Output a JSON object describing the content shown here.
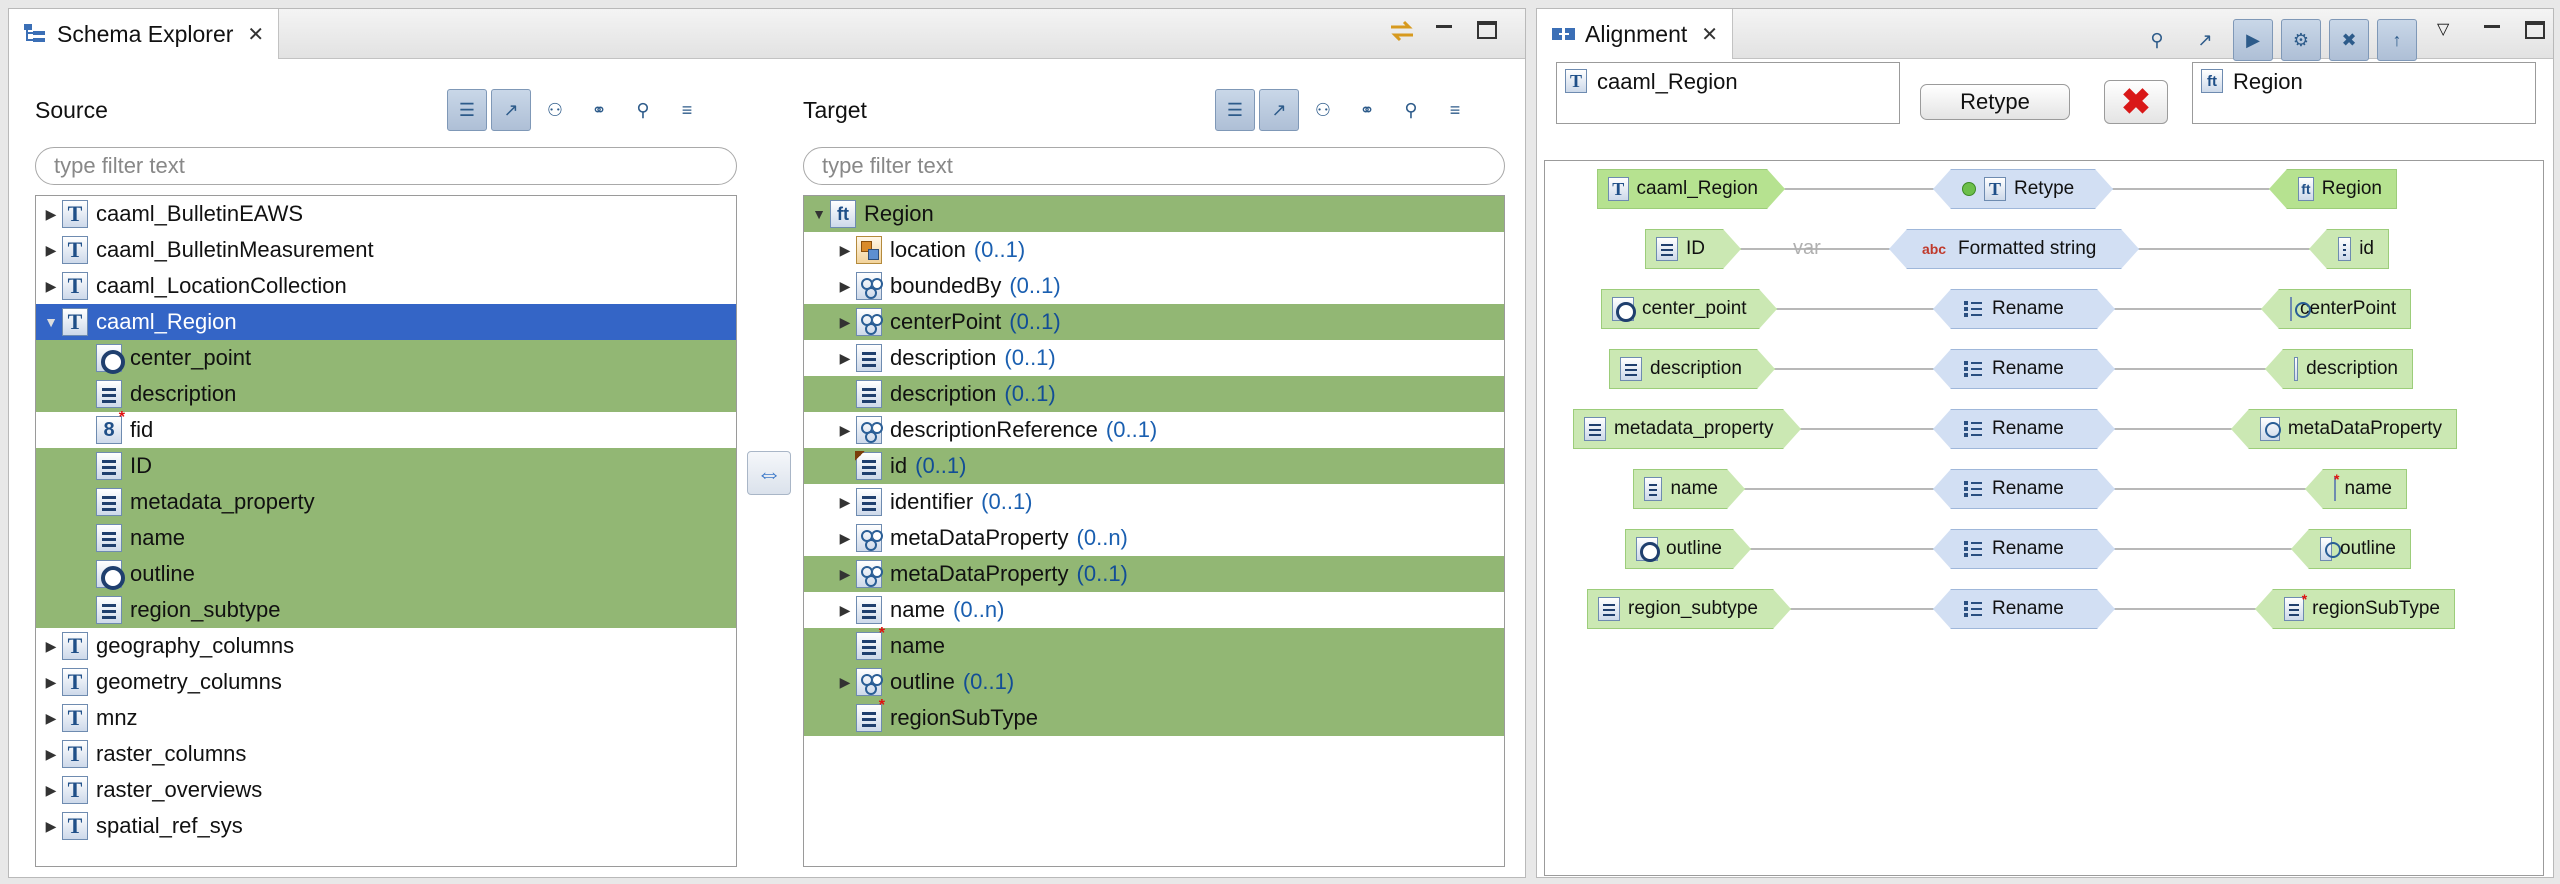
{
  "schema_explorer": {
    "tab_title": "Schema Explorer",
    "source": {
      "title": "Source",
      "filter_placeholder": "type filter text",
      "tree": [
        {
          "label": "caaml_BulletinEAWS",
          "icon": "type-icon",
          "expandable": true
        },
        {
          "label": "caaml_BulletinMeasurement",
          "icon": "type-icon",
          "expandable": true
        },
        {
          "label": "caaml_LocationCollection",
          "icon": "type-icon",
          "expandable": true
        },
        {
          "label": "caaml_Region",
          "icon": "type-icon",
          "expandable": true,
          "expanded": true,
          "selected": true
        },
        {
          "label": "center_point",
          "icon": "geometry-icon",
          "child": true,
          "mapped": true
        },
        {
          "label": "description",
          "icon": "property-icon",
          "child": true,
          "mapped": true
        },
        {
          "label": "fid",
          "icon": "number-icon",
          "child": true,
          "mapped": false
        },
        {
          "label": "ID",
          "icon": "property-icon",
          "child": true,
          "mapped": true
        },
        {
          "label": "metadata_property",
          "icon": "property-icon",
          "child": true,
          "mapped": true
        },
        {
          "label": "name",
          "icon": "property-icon",
          "child": true,
          "mapped": true
        },
        {
          "label": "outline",
          "icon": "geometry-icon",
          "child": true,
          "mapped": true
        },
        {
          "label": "region_subtype",
          "icon": "property-icon",
          "child": true,
          "mapped": true
        },
        {
          "label": "geography_columns",
          "icon": "type-icon",
          "expandable": true
        },
        {
          "label": "geometry_columns",
          "icon": "type-icon",
          "expandable": true
        },
        {
          "label": "mnz",
          "icon": "type-icon",
          "expandable": true
        },
        {
          "label": "raster_columns",
          "icon": "type-icon",
          "expandable": true
        },
        {
          "label": "raster_overviews",
          "icon": "type-icon",
          "expandable": true
        },
        {
          "label": "spatial_ref_sys",
          "icon": "type-icon",
          "expandable": true
        }
      ]
    },
    "target": {
      "title": "Target",
      "filter_placeholder": "type filter text",
      "tree": [
        {
          "label": "Region",
          "card": "",
          "icon": "feature-type-icon",
          "root": true,
          "mapped": true
        },
        {
          "label": "location",
          "card": "(0..1)",
          "icon": "location-icon",
          "expandable": true,
          "mapped": false
        },
        {
          "label": "boundedBy",
          "card": "(0..1)",
          "icon": "group-icon",
          "expandable": true,
          "mapped": false
        },
        {
          "label": "centerPoint",
          "card": "(0..1)",
          "icon": "group-icon",
          "expandable": true,
          "mapped": true
        },
        {
          "label": "description",
          "card": "(0..1)",
          "icon": "property-icon",
          "expandable": true,
          "mapped": false
        },
        {
          "label": "description",
          "card": "(0..1)",
          "icon": "property-icon",
          "expandable": false,
          "mapped": true
        },
        {
          "label": "descriptionReference",
          "card": "(0..1)",
          "icon": "group-icon",
          "expandable": true,
          "mapped": false
        },
        {
          "label": "id",
          "card": "(0..1)",
          "icon": "id-property-icon",
          "expandable": false,
          "mapped": true
        },
        {
          "label": "identifier",
          "card": "(0..1)",
          "icon": "property-icon",
          "expandable": true,
          "mapped": false
        },
        {
          "label": "metaDataProperty",
          "card": "(0..n)",
          "icon": "group-icon",
          "expandable": true,
          "mapped": false
        },
        {
          "label": "metaDataProperty",
          "card": "(0..1)",
          "icon": "group-icon",
          "expandable": true,
          "mapped": true
        },
        {
          "label": "name",
          "card": "(0..n)",
          "icon": "property-icon",
          "expandable": true,
          "mapped": false
        },
        {
          "label": "name",
          "card": "",
          "icon": "required-property-icon",
          "expandable": false,
          "mapped": true
        },
        {
          "label": "outline",
          "card": "(0..1)",
          "icon": "group-icon",
          "expandable": true,
          "mapped": true
        },
        {
          "label": "regionSubType",
          "card": "",
          "icon": "required-property-icon",
          "expandable": false,
          "mapped": true
        }
      ]
    }
  },
  "alignment": {
    "tab_title": "Alignment",
    "header": {
      "source_label": "caaml_Region",
      "function_label": "Retype",
      "target_label": "Region"
    },
    "graph": {
      "rows": [
        {
          "source": "caaml_Region",
          "source_icon": "type-icon",
          "function": "Retype",
          "function_icon": "type-icon",
          "target": "Region",
          "target_icon": "feature-type-icon",
          "var_label": ""
        },
        {
          "source": "ID",
          "source_icon": "property-icon",
          "function": "Formatted string",
          "function_icon": "abc-icon",
          "target": "id",
          "target_icon": "id-property-icon",
          "var_label": "var"
        },
        {
          "source": "center_point",
          "source_icon": "geometry-icon",
          "function": "Rename",
          "function_icon": "rename-icon",
          "target": "centerPoint",
          "target_icon": "group-icon",
          "var_label": ""
        },
        {
          "source": "description",
          "source_icon": "property-icon",
          "function": "Rename",
          "function_icon": "rename-icon",
          "target": "description",
          "target_icon": "property-icon",
          "var_label": ""
        },
        {
          "source": "metadata_property",
          "source_icon": "property-icon",
          "function": "Rename",
          "function_icon": "rename-icon",
          "target": "metaDataProperty",
          "target_icon": "group-icon",
          "var_label": ""
        },
        {
          "source": "name",
          "source_icon": "property-icon",
          "function": "Rename",
          "function_icon": "rename-icon",
          "target": "name",
          "target_icon": "required-property-icon",
          "var_label": ""
        },
        {
          "source": "outline",
          "source_icon": "geometry-icon",
          "function": "Rename",
          "function_icon": "rename-icon",
          "target": "outline",
          "target_icon": "group-icon",
          "var_label": ""
        },
        {
          "source": "region_subtype",
          "source_icon": "property-icon",
          "function": "Rename",
          "function_icon": "rename-icon",
          "target": "regionSubType",
          "target_icon": "required-property-icon",
          "var_label": ""
        }
      ]
    }
  },
  "colors": {
    "mapped_row": "#92b774",
    "selected_row": "#3465c6",
    "node_green": "#cbe8b3",
    "node_blue": "#d2dff3"
  }
}
